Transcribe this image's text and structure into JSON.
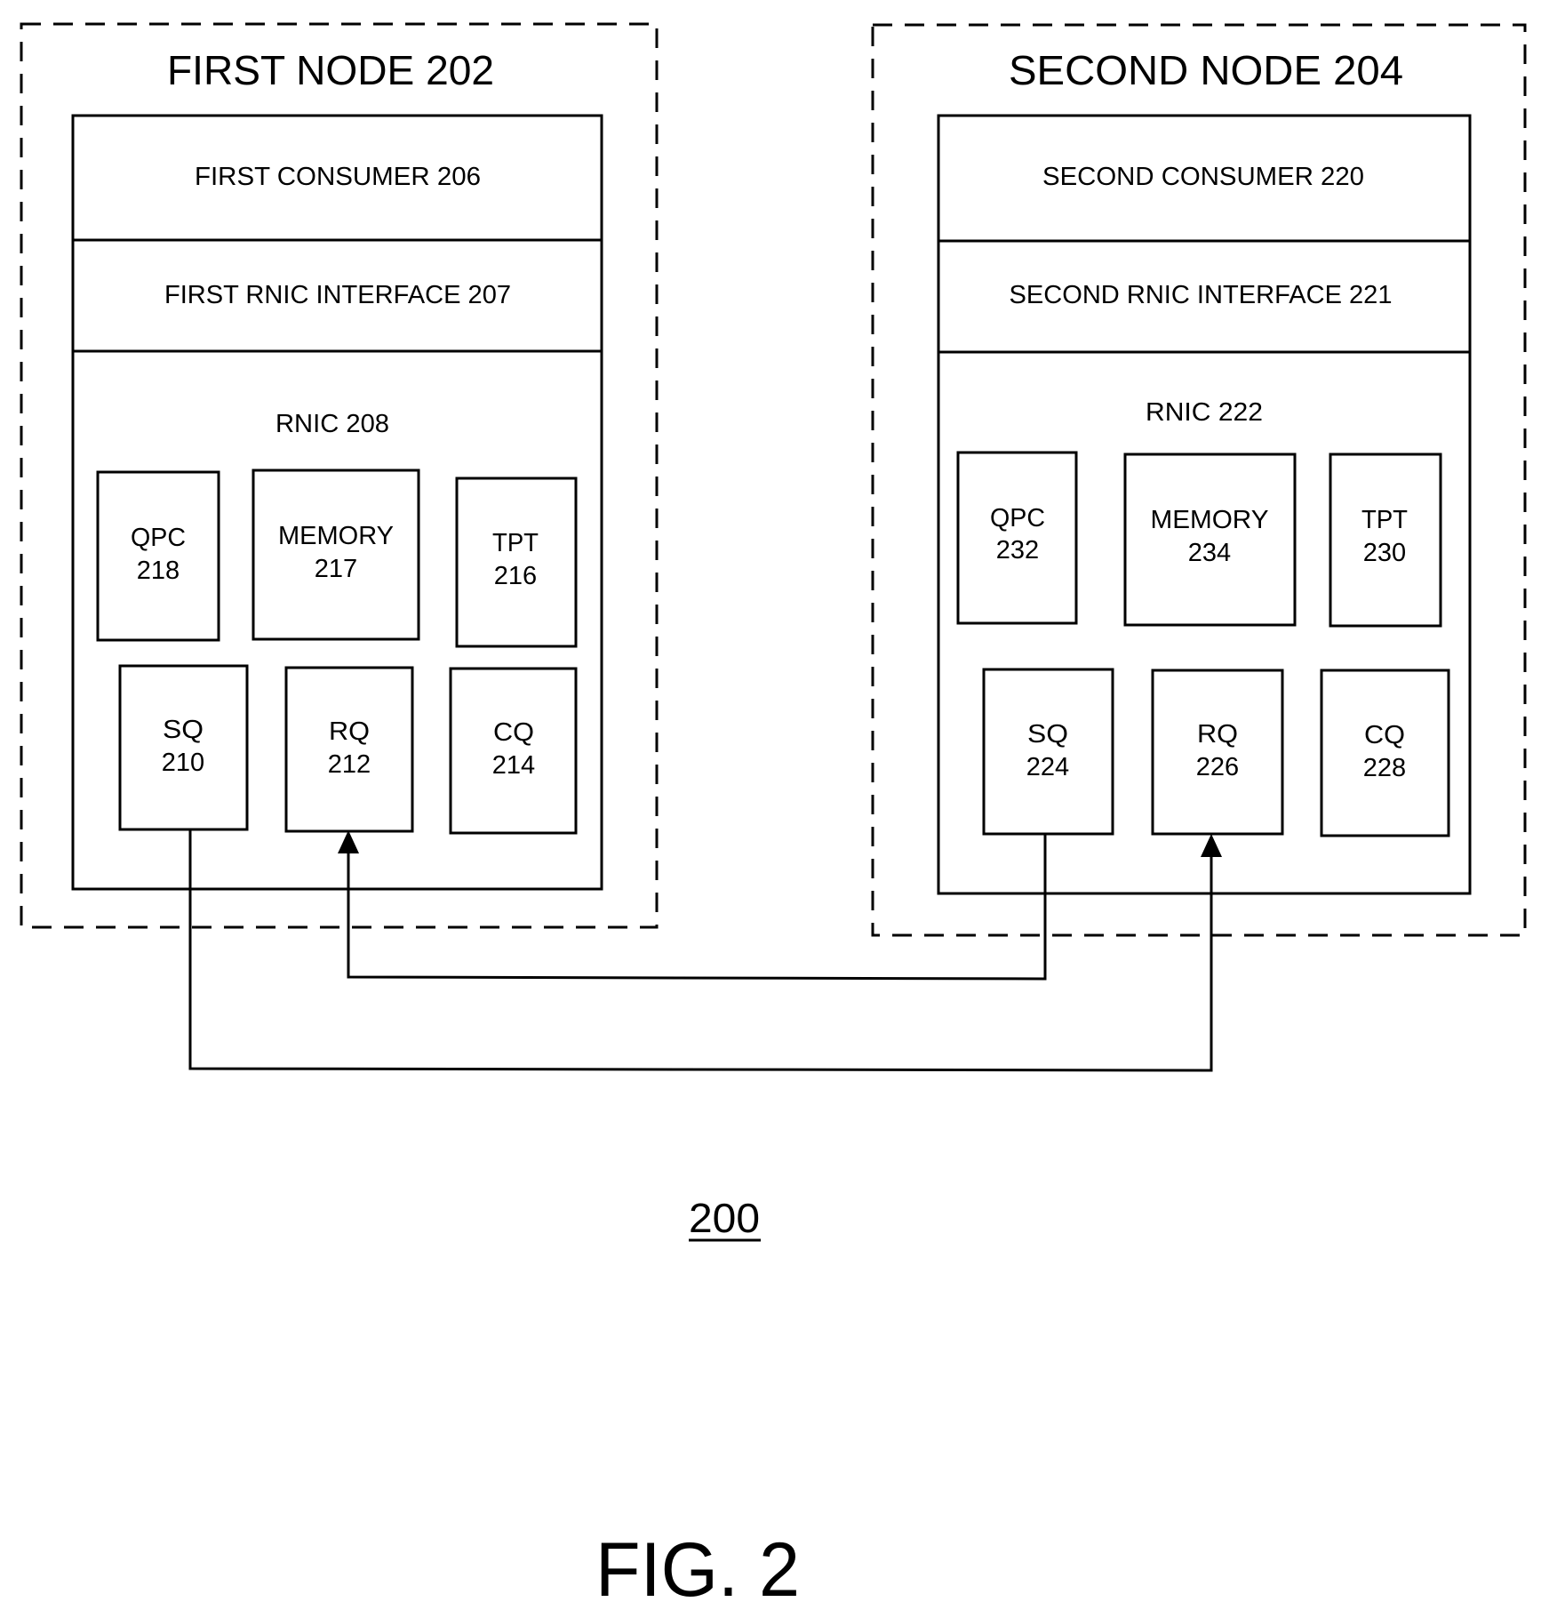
{
  "figure": {
    "reference": "200",
    "caption": "FIG. 2"
  },
  "nodes": [
    {
      "title": "FIRST NODE 202",
      "consumer": "FIRST CONSUMER 206",
      "interface": "FIRST RNIC INTERFACE 207",
      "rnic": "RNIC 208",
      "components": {
        "qpc": [
          "QPC",
          "218"
        ],
        "memory": [
          "MEMORY",
          "217"
        ],
        "tpt": [
          "TPT",
          "216"
        ],
        "sq": [
          "SQ",
          "210"
        ],
        "rq": [
          "RQ",
          "212"
        ],
        "cq": [
          "CQ",
          "214"
        ]
      }
    },
    {
      "title": "SECOND NODE 204",
      "consumer": "SECOND CONSUMER 220",
      "interface": "SECOND RNIC INTERFACE 221",
      "rnic": "RNIC 222",
      "components": {
        "qpc": [
          "QPC",
          "232"
        ],
        "memory": [
          "MEMORY",
          "234"
        ],
        "tpt": [
          "TPT",
          "230"
        ],
        "sq": [
          "SQ",
          "224"
        ],
        "rq": [
          "RQ",
          "226"
        ],
        "cq": [
          "CQ",
          "228"
        ]
      }
    }
  ],
  "connections": [
    {
      "from": "SQ 210",
      "to": "RQ 226",
      "arrow": "at-target"
    },
    {
      "from": "SQ 224",
      "to": "RQ 212",
      "arrow": "at-target"
    }
  ]
}
